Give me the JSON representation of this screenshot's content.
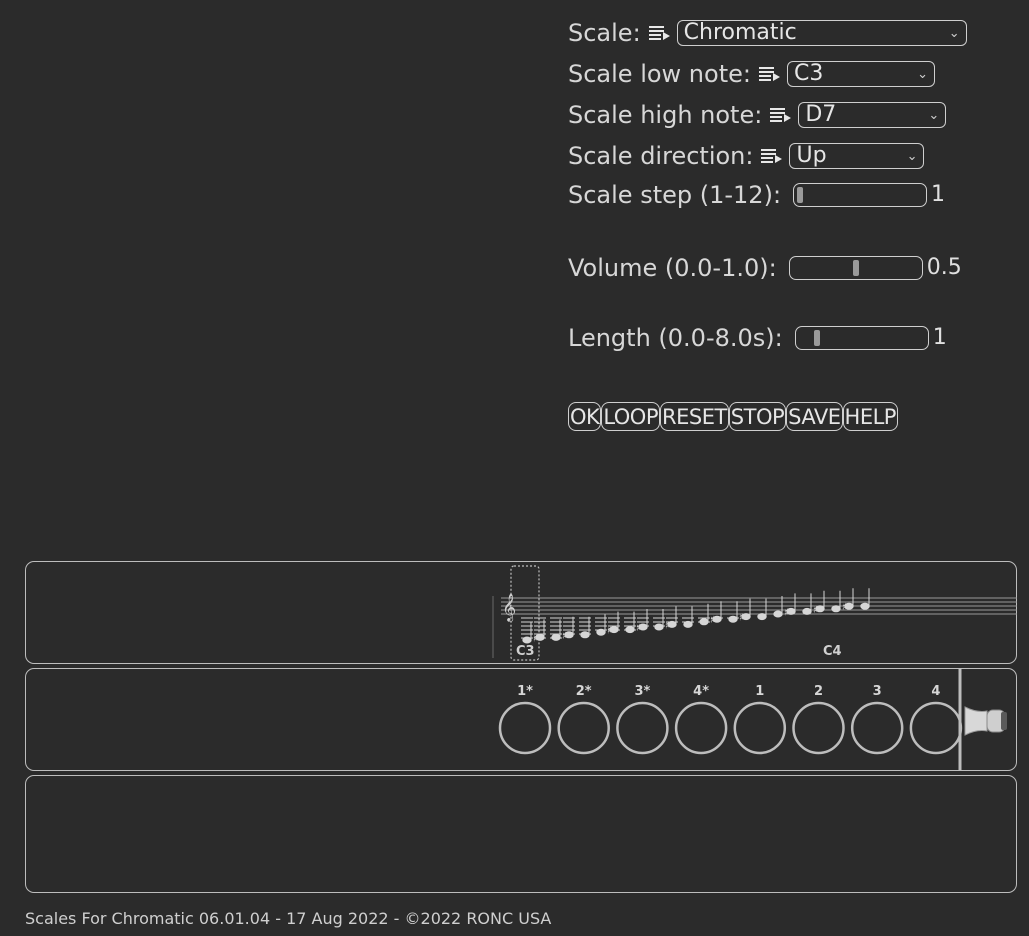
{
  "controls": {
    "scale": {
      "label": "Scale:",
      "value": "Chromatic",
      "icon": "list-select-icon"
    },
    "low_note": {
      "label": "Scale low note:",
      "value": "C3",
      "icon": "list-select-icon"
    },
    "high_note": {
      "label": "Scale high note:",
      "value": "D7",
      "icon": "list-select-icon"
    },
    "direction": {
      "label": "Scale direction:",
      "value": "Up",
      "icon": "list-select-icon"
    },
    "step": {
      "label": "Scale step (1-12):",
      "value": "1",
      "fraction": 0.0
    },
    "volume": {
      "label": "Volume (0.0-1.0):",
      "value": "0.5",
      "fraction": 0.5
    },
    "length": {
      "label": "Length (0.0-8.0s):",
      "value": "1",
      "fraction": 0.125
    }
  },
  "buttons": [
    "OK",
    "LOOP",
    "RESET",
    "STOP",
    "SAVE",
    "HELP"
  ],
  "staff": {
    "clef": "treble-clef-icon",
    "labels": {
      "first": "C3",
      "middle": "C4"
    }
  },
  "holes": {
    "labels": [
      "1*",
      "2*",
      "3*",
      "4*",
      "1",
      "2",
      "3",
      "4"
    ],
    "bell_icon": "horn-bell-icon"
  },
  "footer": "Scales For Chromatic 06.01.04 - 17 Aug 2022 - ©2022 RONC USA",
  "colors": {
    "background": "#2b2b2b",
    "text": "#d7d7d7",
    "border": "#cfcfcf"
  }
}
